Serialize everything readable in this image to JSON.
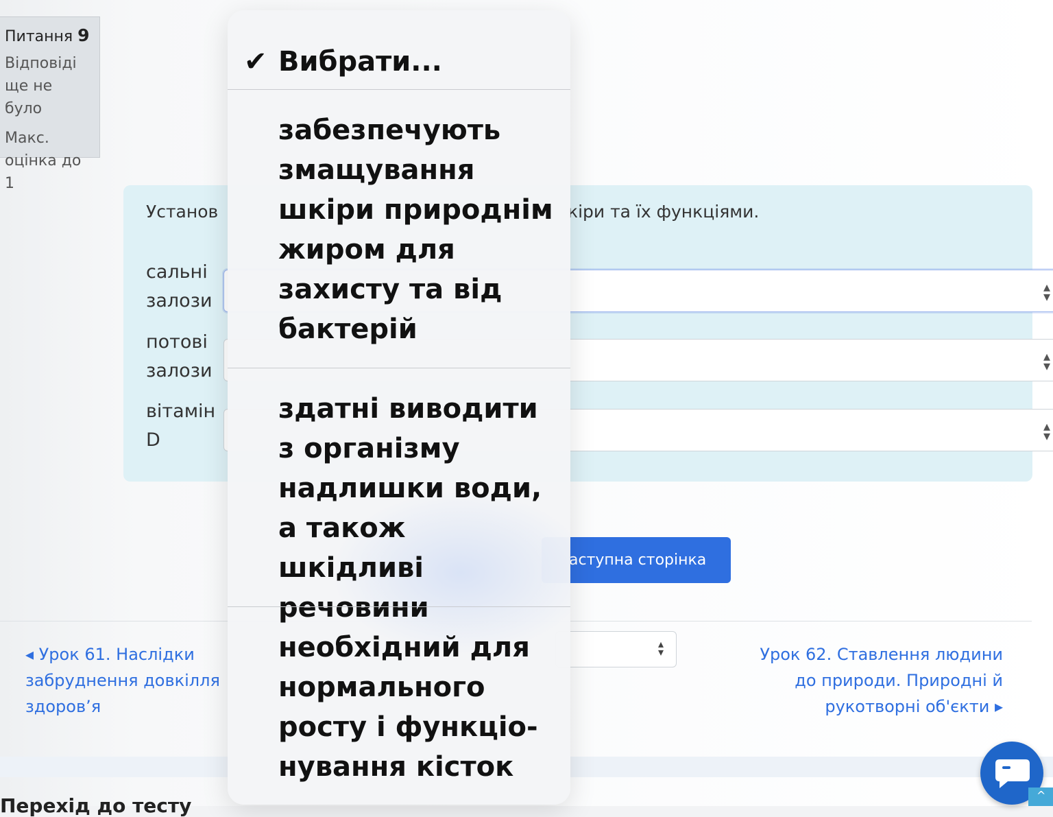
{
  "question_info": {
    "number_label": "Питання",
    "number": "9",
    "state": "Відповіді ще не було",
    "grade": "Макс. оцінка до 1"
  },
  "question": {
    "prompt_left": "Установ",
    "prompt_right": "кіри та їх функціями.",
    "rows": [
      {
        "label": "сальні залози"
      },
      {
        "label": "потові залози"
      },
      {
        "label": "вітамін D"
      }
    ]
  },
  "buttons": {
    "next_page": "аступна сторінка"
  },
  "navigation": {
    "prev_link": "◂ Урок 61. Наслідки забруднення довкілля здоров’я",
    "next_link": "Урок 62. Ставлення людини до природи. Природні й рукотворні об'єкти ▸"
  },
  "footer": {
    "heading": "Перехід до тесту"
  },
  "picker": {
    "options": [
      {
        "label": "Вибрати...",
        "selected": true
      },
      {
        "label": "забезпечують змащування шкіри природнім жиром для захисту та від бактерій",
        "selected": false
      },
      {
        "label": "здатні виводити з організму надлишки води, а також шкідливі речовини",
        "selected": false
      },
      {
        "label": "необхідний для нормального росту і функціо-нування кісток",
        "selected": false
      }
    ]
  },
  "icons": {
    "check": "checkmark-icon",
    "chat": "chat-bubble-icon",
    "scroll_top": "chevron-up-icon",
    "select_arrows": "updown-arrows-icon"
  },
  "colors": {
    "accent": "#2f6fe0",
    "panel": "#def1f6",
    "chat_fab": "#1f66c9"
  }
}
